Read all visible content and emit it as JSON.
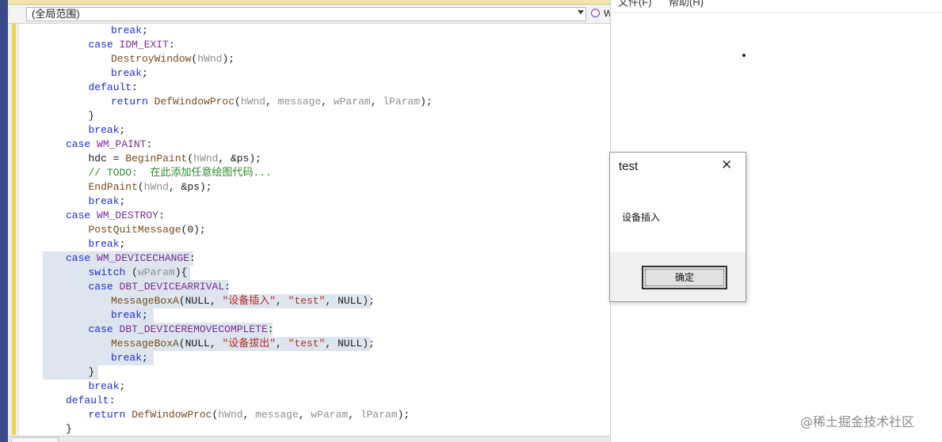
{
  "ide": {
    "scope": "(全局范围)",
    "member": "W",
    "code_lines": [
      [
        {
          "c": "kw",
          "t": "break"
        },
        {
          "c": "",
          "t": ";"
        }
      ],
      [
        {
          "c": "kw",
          "t": "case "
        },
        {
          "c": "mc",
          "t": "IDM_EXIT"
        },
        {
          "c": "",
          "t": ":"
        }
      ],
      [
        {
          "c": "fn",
          "t": "DestroyWindow"
        },
        {
          "c": "",
          "t": "("
        },
        {
          "c": "pm",
          "t": "hWnd"
        },
        {
          "c": "",
          "t": ");"
        }
      ],
      [
        {
          "c": "kw",
          "t": "break"
        },
        {
          "c": "",
          "t": ";"
        }
      ],
      [
        {
          "c": "kw",
          "t": "default"
        },
        {
          "c": "",
          "t": ":"
        }
      ],
      [
        {
          "c": "kw",
          "t": "return "
        },
        {
          "c": "fn",
          "t": "DefWindowProc"
        },
        {
          "c": "",
          "t": "("
        },
        {
          "c": "pm",
          "t": "hWnd"
        },
        {
          "c": "",
          "t": ", "
        },
        {
          "c": "pm",
          "t": "message"
        },
        {
          "c": "",
          "t": ", "
        },
        {
          "c": "pm",
          "t": "wParam"
        },
        {
          "c": "",
          "t": ", "
        },
        {
          "c": "pm",
          "t": "lParam"
        },
        {
          "c": "",
          "t": ");"
        }
      ],
      [
        {
          "c": "",
          "t": "}"
        }
      ],
      [
        {
          "c": "kw",
          "t": "break"
        },
        {
          "c": "",
          "t": ";"
        }
      ],
      [
        {
          "c": "kw",
          "t": "case "
        },
        {
          "c": "mc",
          "t": "WM_PAINT"
        },
        {
          "c": "",
          "t": ":"
        }
      ],
      [
        {
          "c": "",
          "t": "hdc = "
        },
        {
          "c": "fn",
          "t": "BeginPaint"
        },
        {
          "c": "",
          "t": "("
        },
        {
          "c": "pm",
          "t": "hWnd"
        },
        {
          "c": "",
          "t": ", &ps);"
        }
      ],
      [
        {
          "c": "cm",
          "t": "// TODO:  在此添加任意绘图代码..."
        }
      ],
      [
        {
          "c": "fn",
          "t": "EndPaint"
        },
        {
          "c": "",
          "t": "("
        },
        {
          "c": "pm",
          "t": "hWnd"
        },
        {
          "c": "",
          "t": ", &ps);"
        }
      ],
      [
        {
          "c": "kw",
          "t": "break"
        },
        {
          "c": "",
          "t": ";"
        }
      ],
      [
        {
          "c": "kw",
          "t": "case "
        },
        {
          "c": "mc",
          "t": "WM_DESTROY"
        },
        {
          "c": "",
          "t": ":"
        }
      ],
      [
        {
          "c": "fn",
          "t": "PostQuitMessage"
        },
        {
          "c": "",
          "t": "(0);"
        }
      ],
      [
        {
          "c": "kw",
          "t": "break"
        },
        {
          "c": "",
          "t": ";"
        }
      ],
      [
        {
          "c": "kw",
          "t": "case "
        },
        {
          "c": "mc",
          "t": "WM_DEVICECHANGE"
        },
        {
          "c": "",
          "t": ":"
        }
      ],
      [
        {
          "c": "kw",
          "t": "switch "
        },
        {
          "c": "",
          "t": "("
        },
        {
          "c": "pm",
          "t": "wParam"
        },
        {
          "c": "",
          "t": "){"
        }
      ],
      [
        {
          "c": "kw",
          "t": "case "
        },
        {
          "c": "mc",
          "t": "DBT_DEVICEARRIVAL"
        },
        {
          "c": "",
          "t": ":"
        }
      ],
      [
        {
          "c": "fn",
          "t": "MessageBoxA"
        },
        {
          "c": "",
          "t": "(NULL, "
        },
        {
          "c": "st",
          "t": "\"设备插入\""
        },
        {
          "c": "",
          "t": ", "
        },
        {
          "c": "st",
          "t": "\"test\""
        },
        {
          "c": "",
          "t": ", NULL);"
        }
      ],
      [
        {
          "c": "kw",
          "t": "break"
        },
        {
          "c": "",
          "t": ";"
        }
      ],
      [
        {
          "c": "kw",
          "t": "case "
        },
        {
          "c": "mc",
          "t": "DBT_DEVICEREMOVECOMPLETE"
        },
        {
          "c": "",
          "t": ":"
        }
      ],
      [
        {
          "c": "fn",
          "t": "MessageBoxA"
        },
        {
          "c": "",
          "t": "(NULL, "
        },
        {
          "c": "st",
          "t": "\"设备拔出\""
        },
        {
          "c": "",
          "t": ", "
        },
        {
          "c": "st",
          "t": "\"test\""
        },
        {
          "c": "",
          "t": ", NULL);"
        }
      ],
      [
        {
          "c": "kw",
          "t": "break"
        },
        {
          "c": "",
          "t": ";"
        }
      ],
      [
        {
          "c": "",
          "t": "}"
        }
      ],
      [
        {
          "c": "kw",
          "t": "break"
        },
        {
          "c": "",
          "t": ";"
        }
      ],
      [
        {
          "c": "kw",
          "t": "default"
        },
        {
          "c": "",
          "t": ":"
        }
      ],
      [
        {
          "c": "kw",
          "t": "return "
        },
        {
          "c": "fn",
          "t": "DefWindowProc"
        },
        {
          "c": "",
          "t": "("
        },
        {
          "c": "pm",
          "t": "hWnd"
        },
        {
          "c": "",
          "t": ", "
        },
        {
          "c": "pm",
          "t": "message"
        },
        {
          "c": "",
          "t": ", "
        },
        {
          "c": "pm",
          "t": "wParam"
        },
        {
          "c": "",
          "t": ", "
        },
        {
          "c": "pm",
          "t": "lParam"
        },
        {
          "c": "",
          "t": ");"
        }
      ],
      [
        {
          "c": "",
          "t": "}"
        }
      ]
    ]
  },
  "app": {
    "menu": [
      "文件(F)",
      "帮助(H)"
    ]
  },
  "msgbox": {
    "title": "test",
    "text": "设备插入",
    "ok_label": "确定",
    "close_icon": "close-icon"
  },
  "watermark": "@稀土掘金技术社区",
  "colors": {
    "keyword": "#1f2ed4",
    "macro": "#7a2c96",
    "function": "#7b4b1a",
    "param": "#8f8f8f",
    "string": "#b32c2c",
    "comment": "#2d8a2d",
    "selection": "#dde6ee"
  }
}
